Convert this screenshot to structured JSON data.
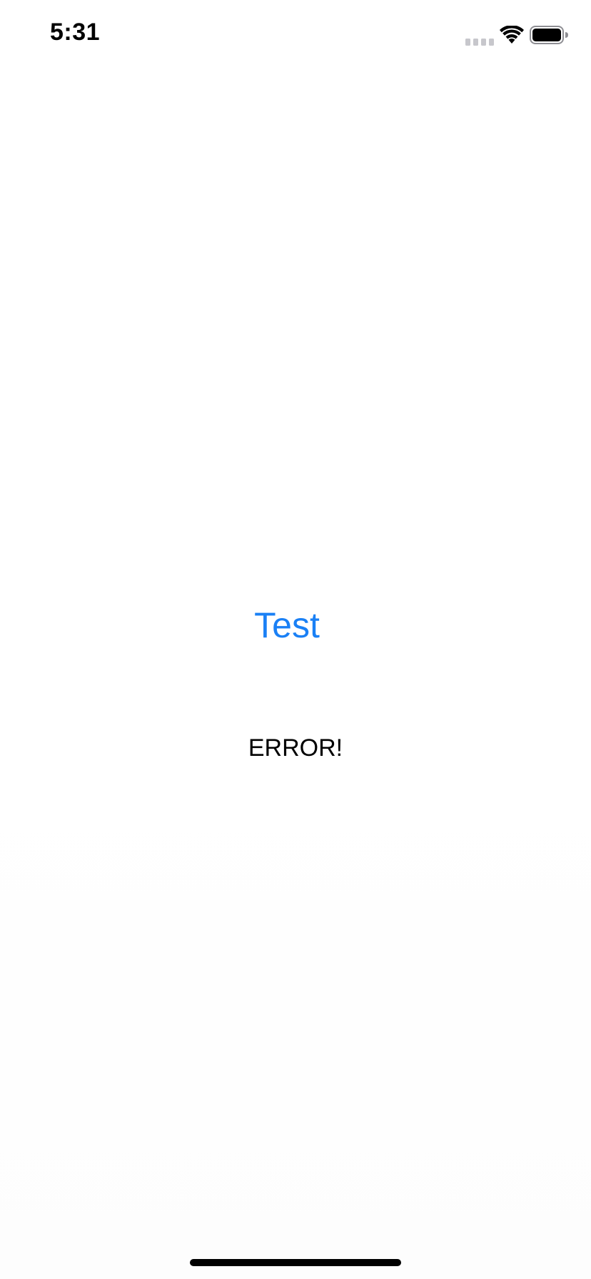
{
  "status_bar": {
    "time": "5:31",
    "icons": [
      "cellular-signal-icon",
      "wifi-icon",
      "battery-icon"
    ]
  },
  "main": {
    "button_label": "Test",
    "message": "ERROR!"
  },
  "colors": {
    "accent": "#1a80f5",
    "text": "#000000",
    "background": "#ffffff"
  }
}
